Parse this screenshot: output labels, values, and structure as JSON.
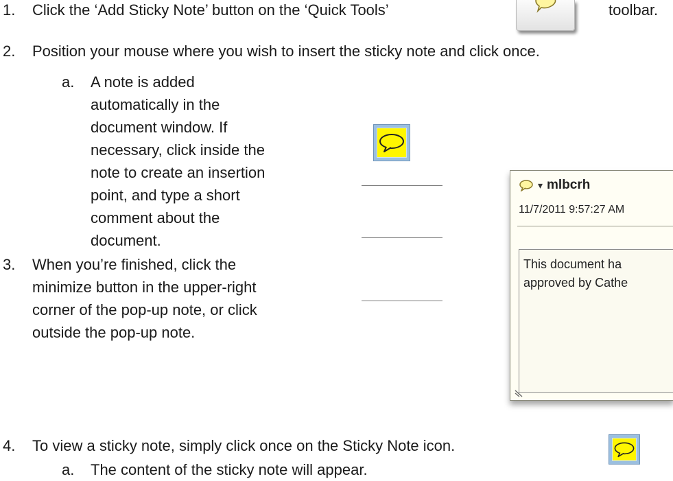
{
  "steps": [
    {
      "num": "1.",
      "text": "Click the ‘Add Sticky Note’ button on the ‘Quick Tools’",
      "text_after": "toolbar."
    },
    {
      "num": "2.",
      "text": "Position your mouse where you wish to insert the sticky note and click once."
    },
    {
      "num": "3.",
      "lines": [
        "When you’re finished, click the",
        "minimize button in the upper-right",
        "corner of the pop-up note, or click",
        "outside the pop-up note."
      ]
    },
    {
      "num": "4.",
      "text": "To view a sticky note, simply click once on the Sticky Note icon."
    }
  ],
  "substeps": [
    {
      "letter": "a.",
      "lines": [
        "A note is added",
        "automatically in the",
        "document window. If",
        "necessary, click inside the",
        "note to create an insertion",
        "point, and type a short",
        "comment about the",
        "document."
      ]
    },
    {
      "letter": "a.",
      "text": "The content of the sticky note will appear."
    }
  ],
  "note_popup": {
    "author": "mlbcrh",
    "date": "11/7/2011 9:57:27 AM",
    "body_lines": [
      "This document ha",
      "approved by Cathe"
    ],
    "menu_arrow": "▾"
  },
  "icons": {
    "toolbar_button": "speech-bubble-icon",
    "sticky_note": "sticky-note-icon",
    "resize_grip": "resize-grip-icon"
  },
  "colors": {
    "sticky_yellow": "#fff600",
    "sticky_border": "#9bbfe0"
  }
}
